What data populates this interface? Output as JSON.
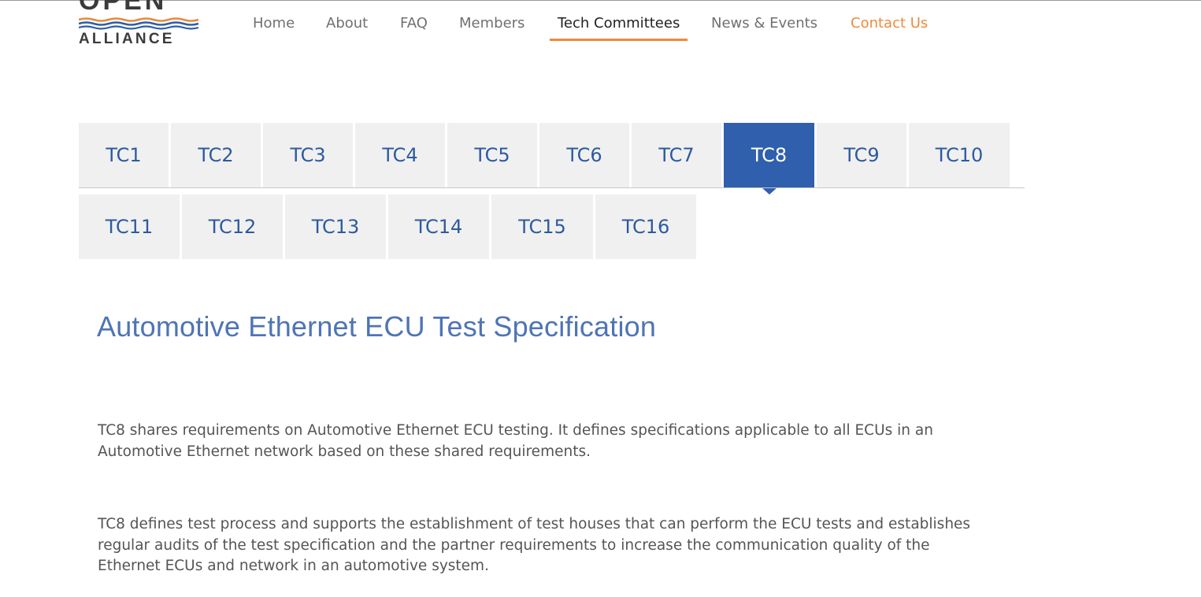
{
  "logo": {
    "line1": "OPEN",
    "line2": "ALLIANCE",
    "wave_colors": [
      "#e8893a",
      "#2e5ea8"
    ]
  },
  "nav": {
    "items": [
      {
        "label": "Home"
      },
      {
        "label": "About"
      },
      {
        "label": "FAQ"
      },
      {
        "label": "Members"
      },
      {
        "label": "Tech Committees",
        "active": true
      },
      {
        "label": "News & Events"
      },
      {
        "label": "Contact Us",
        "highlight": true
      }
    ]
  },
  "tabs": {
    "row1": [
      "TC1",
      "TC2",
      "TC3",
      "TC4",
      "TC5",
      "TC6",
      "TC7",
      "TC8",
      "TC9",
      "TC10"
    ],
    "row2": [
      "TC11",
      "TC12",
      "TC13",
      "TC14",
      "TC15",
      "TC16"
    ],
    "selected": "TC8"
  },
  "content": {
    "heading": "Automotive Ethernet ECU Test Specification",
    "paragraphs": [
      "TC8 shares requirements on Automotive Ethernet ECU testing. It defines specifications applicable to all ECUs in an Automotive Ethernet network based on these shared requirements.",
      "TC8 defines test process and supports the establishment of test houses that can perform the ECU tests and establishes regular audits of the test specification and the partner requirements to increase the communication quality of the Ethernet ECUs and network in an automotive system."
    ]
  },
  "colors": {
    "accent_orange": "#ee8a3c",
    "tab_active_blue": "#2f5fad",
    "tab_text_blue": "#2c5aa0",
    "heading_blue": "#4e74b5",
    "tab_bg": "#f0f0f0"
  }
}
